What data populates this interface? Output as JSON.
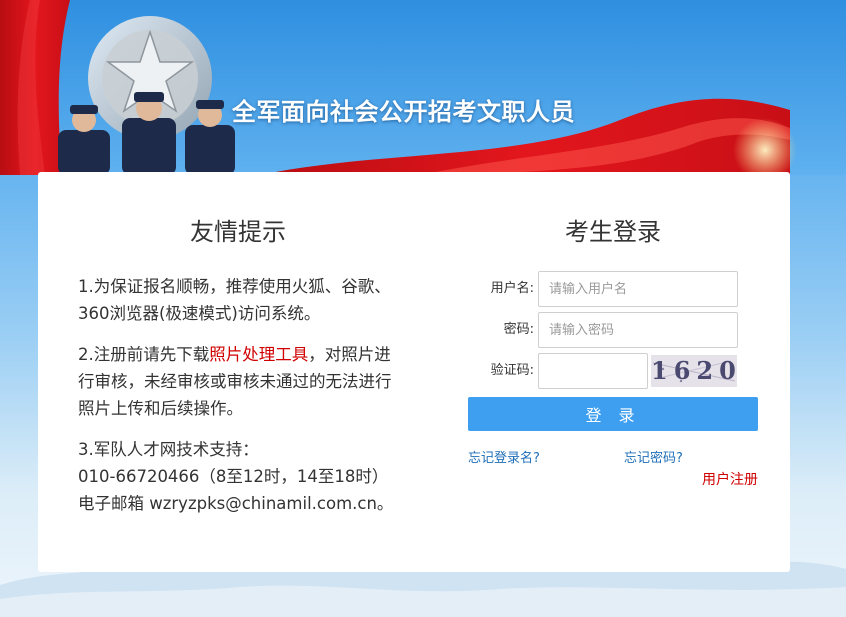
{
  "header": {
    "site_title": "全军面向社会公开招考文职人员"
  },
  "notice": {
    "title": "友情提示",
    "item1": "1.为保证报名顺畅，推荐使用火狐、谷歌、360浏览器(极速模式)访问系统。",
    "item2_before": "2.注册前请先下载",
    "item2_link": "照片处理工具",
    "item2_after": "，对照片进行审核，未经审核或审核未通过的无法进行照片上传和后续操作。",
    "item3_line1": "3.军队人才网技术支持：",
    "item3_line2": "010-66720466（8至12时，14至18时）",
    "item3_line3": "电子邮箱 wzryzpks@chinamil.com.cn。"
  },
  "login": {
    "title": "考生登录",
    "username_label": "用户名:",
    "username_placeholder": "请输入用户名",
    "password_label": "密码:",
    "password_placeholder": "请输入密码",
    "captcha_label": "验证码:",
    "captcha_text": "1620",
    "submit_label": "登 录",
    "forgot_username": "忘记登录名?",
    "forgot_password": "忘记密码?",
    "register": "用户注册"
  },
  "colors": {
    "accent_blue": "#3e9ff1",
    "link_blue": "#1f6fb8",
    "alert_red": "#d00000",
    "flag_red": "#d8141b"
  }
}
